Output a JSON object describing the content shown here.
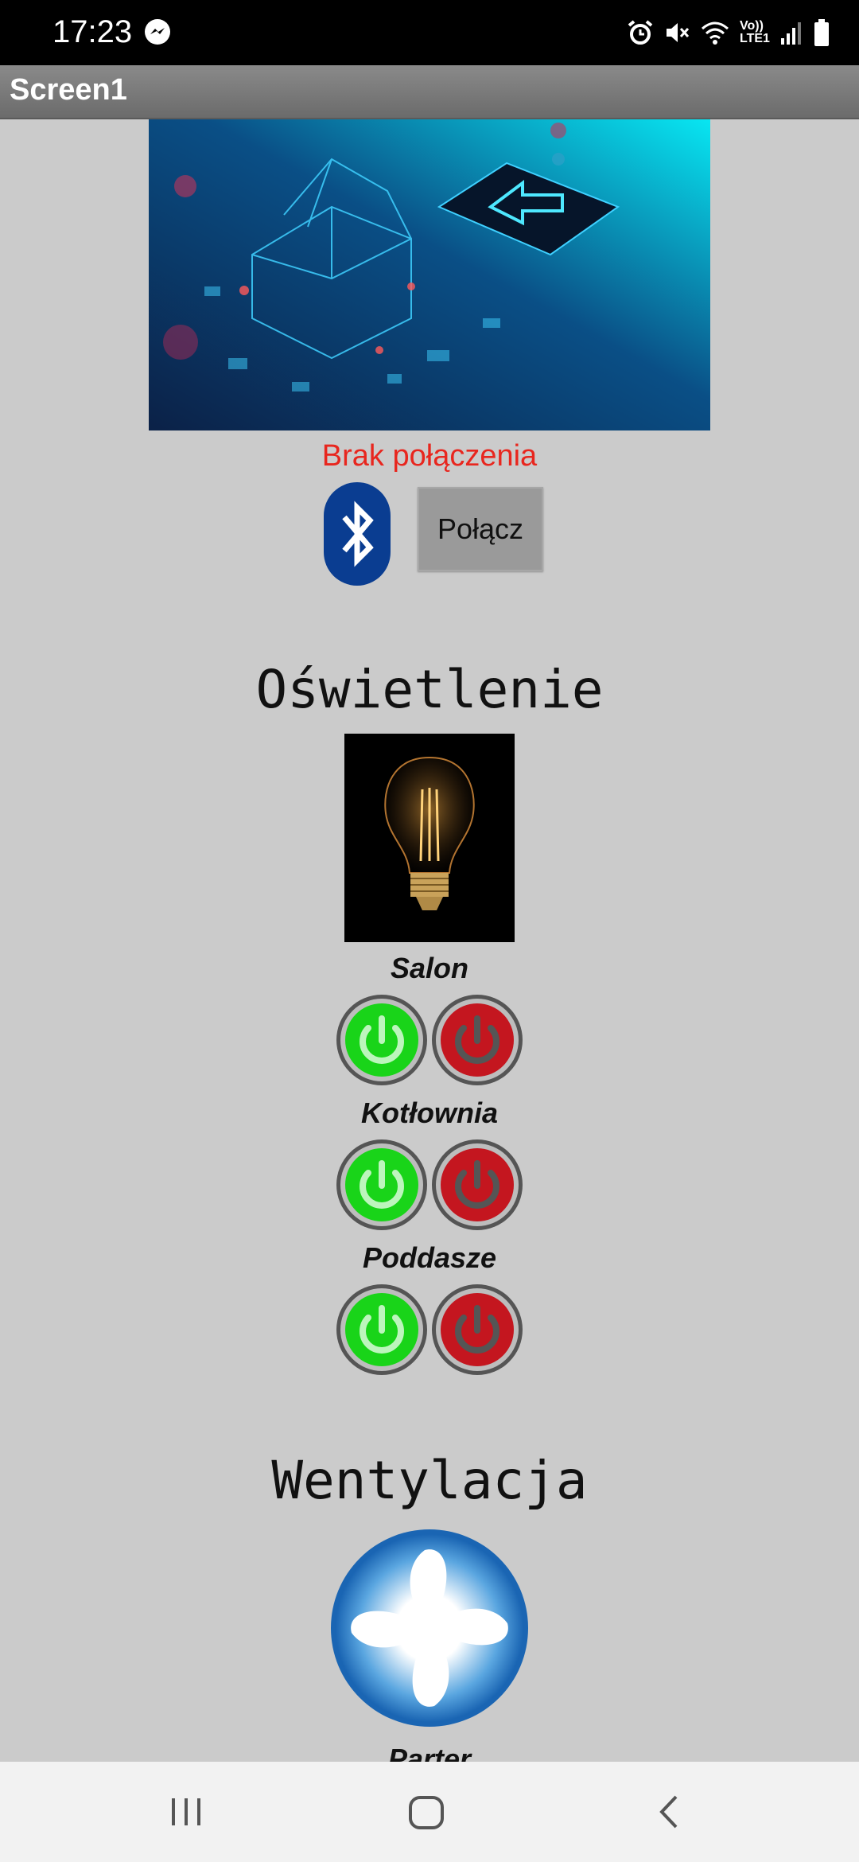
{
  "status_bar": {
    "time": "17:23",
    "network_label": "Vo)) LTE1"
  },
  "app_bar": {
    "title": "Screen1"
  },
  "connection": {
    "status": "Brak połączenia",
    "status_color": "#e8261e",
    "connect_label": "Połącz"
  },
  "lighting": {
    "title": "Oświetlenie",
    "rooms": [
      {
        "label": "Salon"
      },
      {
        "label": "Kotłownia"
      },
      {
        "label": "Poddasze"
      }
    ]
  },
  "ventilation": {
    "title": "Wentylacja",
    "rooms": [
      {
        "label": "Parter"
      }
    ]
  },
  "colors": {
    "on": "#19d419",
    "off": "#c4161f",
    "bluetooth": "#0a3d91"
  }
}
